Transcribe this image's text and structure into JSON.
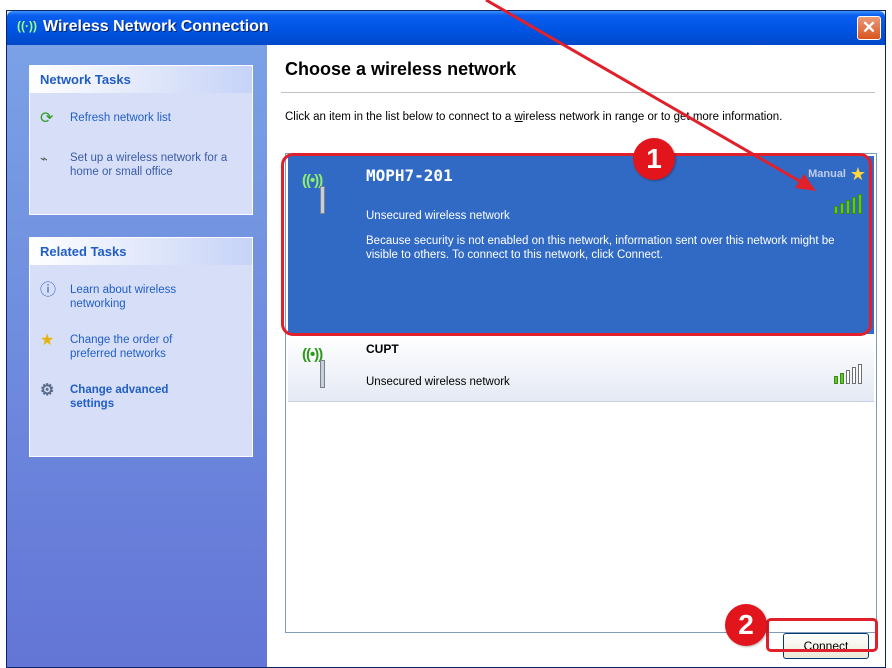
{
  "window": {
    "title": "Wireless Network Connection",
    "close_glyph": "✕"
  },
  "sidebar": {
    "network_tasks": {
      "header": "Network Tasks",
      "items": [
        {
          "label": "Refresh network list",
          "icon": "refresh-icon"
        },
        {
          "label": "Set up a wireless network for a home or small office",
          "icon": "wireless-setup-icon"
        }
      ]
    },
    "related_tasks": {
      "header": "Related Tasks",
      "items": [
        {
          "label": "Learn about wireless networking",
          "icon": "info-icon"
        },
        {
          "label": "Change the order of preferred networks",
          "icon": "star-icon"
        },
        {
          "label": "Change advanced settings",
          "icon": "settings-icon"
        }
      ]
    }
  },
  "main": {
    "title": "Choose a wireless network",
    "instruction_pre": "Click an item in the list below to connect to a ",
    "instruction_link": "w",
    "instruction_post": "ireless network in range or to get more information.",
    "networks": [
      {
        "name": "MOPH7-201",
        "status": "Unsecured wireless network",
        "tag": "Manual",
        "description": "Because security is not enabled on this network, information sent over this network might be visible to others. To connect to this network, click Connect.",
        "signal_bars": 5,
        "selected": true
      },
      {
        "name": "CUPT",
        "status": "Unsecured wireless network",
        "signal_bars": 2,
        "selected": false
      }
    ],
    "connect_button": {
      "underlined": "C",
      "rest": "onnect"
    }
  },
  "annotations": {
    "badge_1": "1",
    "badge_2": "2",
    "highlight_color": "#e0202a"
  }
}
